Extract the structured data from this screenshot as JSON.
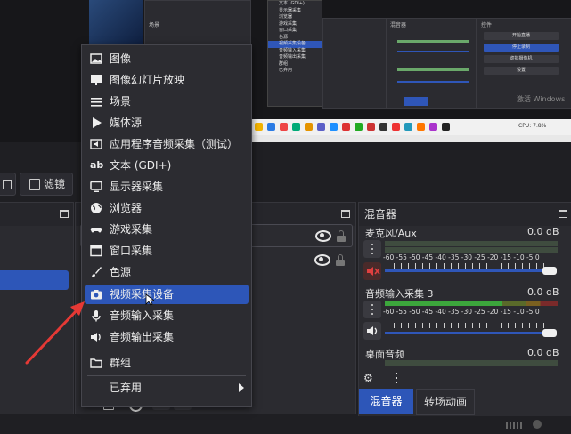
{
  "preview": {
    "mini_titles": [
      "场景",
      "混音器",
      "控件"
    ],
    "mini_buttons": [
      "开始直播",
      "停止录制",
      "虚拟摄像机",
      "设置"
    ],
    "mini_menu_items": [
      "文本 (GDI+)",
      "显示器采集",
      "浏览器",
      "游戏采集",
      "窗口采集",
      "色源",
      "视频采集设备",
      "音频输入采集",
      "音频输出采集",
      "群组",
      "已弃用"
    ],
    "watermark": "激活 Windows",
    "status": "CPU: 7.8%"
  },
  "toolbar": {
    "filter_label": "滤镜"
  },
  "panels": {
    "mixer_title": "混音器"
  },
  "mixer": {
    "channels": [
      {
        "name": "麦克风/Aux",
        "db": "0.0 dB",
        "muted": true
      },
      {
        "name": "音频输入采集 3",
        "db": "0.0 dB",
        "muted": false
      },
      {
        "name": "桌面音频",
        "db": "0.0 dB",
        "muted": false
      }
    ],
    "ticks": "-60 -55 -50 -45 -40 -35 -30 -25 -20 -15 -10  -5  0"
  },
  "tabs": {
    "mixer": "混音器",
    "transition": "转场动画"
  },
  "context_menu": {
    "items": [
      {
        "label": "图像",
        "icon": "image-icon"
      },
      {
        "label": "图像幻灯片放映",
        "icon": "slideshow-icon"
      },
      {
        "label": "场景",
        "icon": "scene-icon"
      },
      {
        "label": "媒体源",
        "icon": "play-icon"
      },
      {
        "label": "应用程序音频采集（测试）",
        "icon": "app-audio-icon"
      },
      {
        "label": "文本 (GDI+)",
        "icon": "text-icon"
      },
      {
        "label": "显示器采集",
        "icon": "monitor-icon"
      },
      {
        "label": "浏览器",
        "icon": "globe-icon"
      },
      {
        "label": "游戏采集",
        "icon": "gamepad-icon"
      },
      {
        "label": "窗口采集",
        "icon": "window-icon"
      },
      {
        "label": "色源",
        "icon": "brush-icon"
      },
      {
        "label": "视频采集设备",
        "icon": "camera-icon"
      },
      {
        "label": "音频输入采集",
        "icon": "microphone-icon"
      },
      {
        "label": "音频输出采集",
        "icon": "speaker-icon"
      },
      {
        "label": "群组",
        "icon": "folder-icon"
      },
      {
        "label": "已弃用",
        "icon": "submenu-arrow-icon"
      }
    ]
  },
  "colors": {
    "accent": "#2d56b8",
    "panel": "#2b2b30",
    "arrow": "#e53935"
  }
}
